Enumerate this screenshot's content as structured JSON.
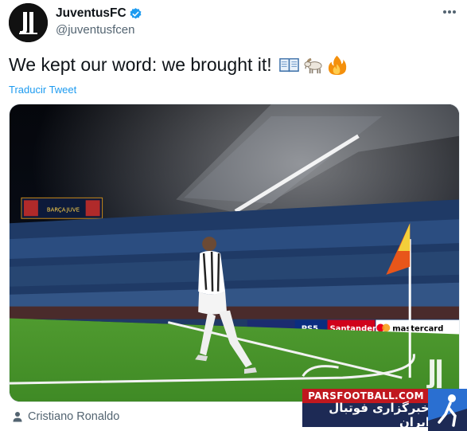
{
  "account": {
    "display_name": "JuventusFC",
    "handle": "@juventusfcen",
    "verified": true,
    "avatar_icon": "juventus-logo-icon"
  },
  "tweet": {
    "text": "We kept our word: we brought it!",
    "emojis": [
      "open-book-icon",
      "goat-icon",
      "fire-icon"
    ],
    "translate_label": "Traducir Tweet"
  },
  "media": {
    "alt": "",
    "scoreboard_left": "BARÇA",
    "scoreboard_right": "JUVE",
    "ad_boards": [
      "PS5",
      "Santander",
      "mastercard"
    ]
  },
  "tagged_people": {
    "icon": "person-icon",
    "name": "Cristiano Ronaldo"
  },
  "watermark": {
    "site": "PARSFOOTBALL.COM",
    "tagline": "خبرگزاری فوتبال ایران"
  },
  "colors": {
    "accent": "#1d9bf0",
    "text": "#0f1419",
    "muted": "#536471",
    "watermark_red": "#c0181f",
    "watermark_navy": "#1d2a55"
  }
}
